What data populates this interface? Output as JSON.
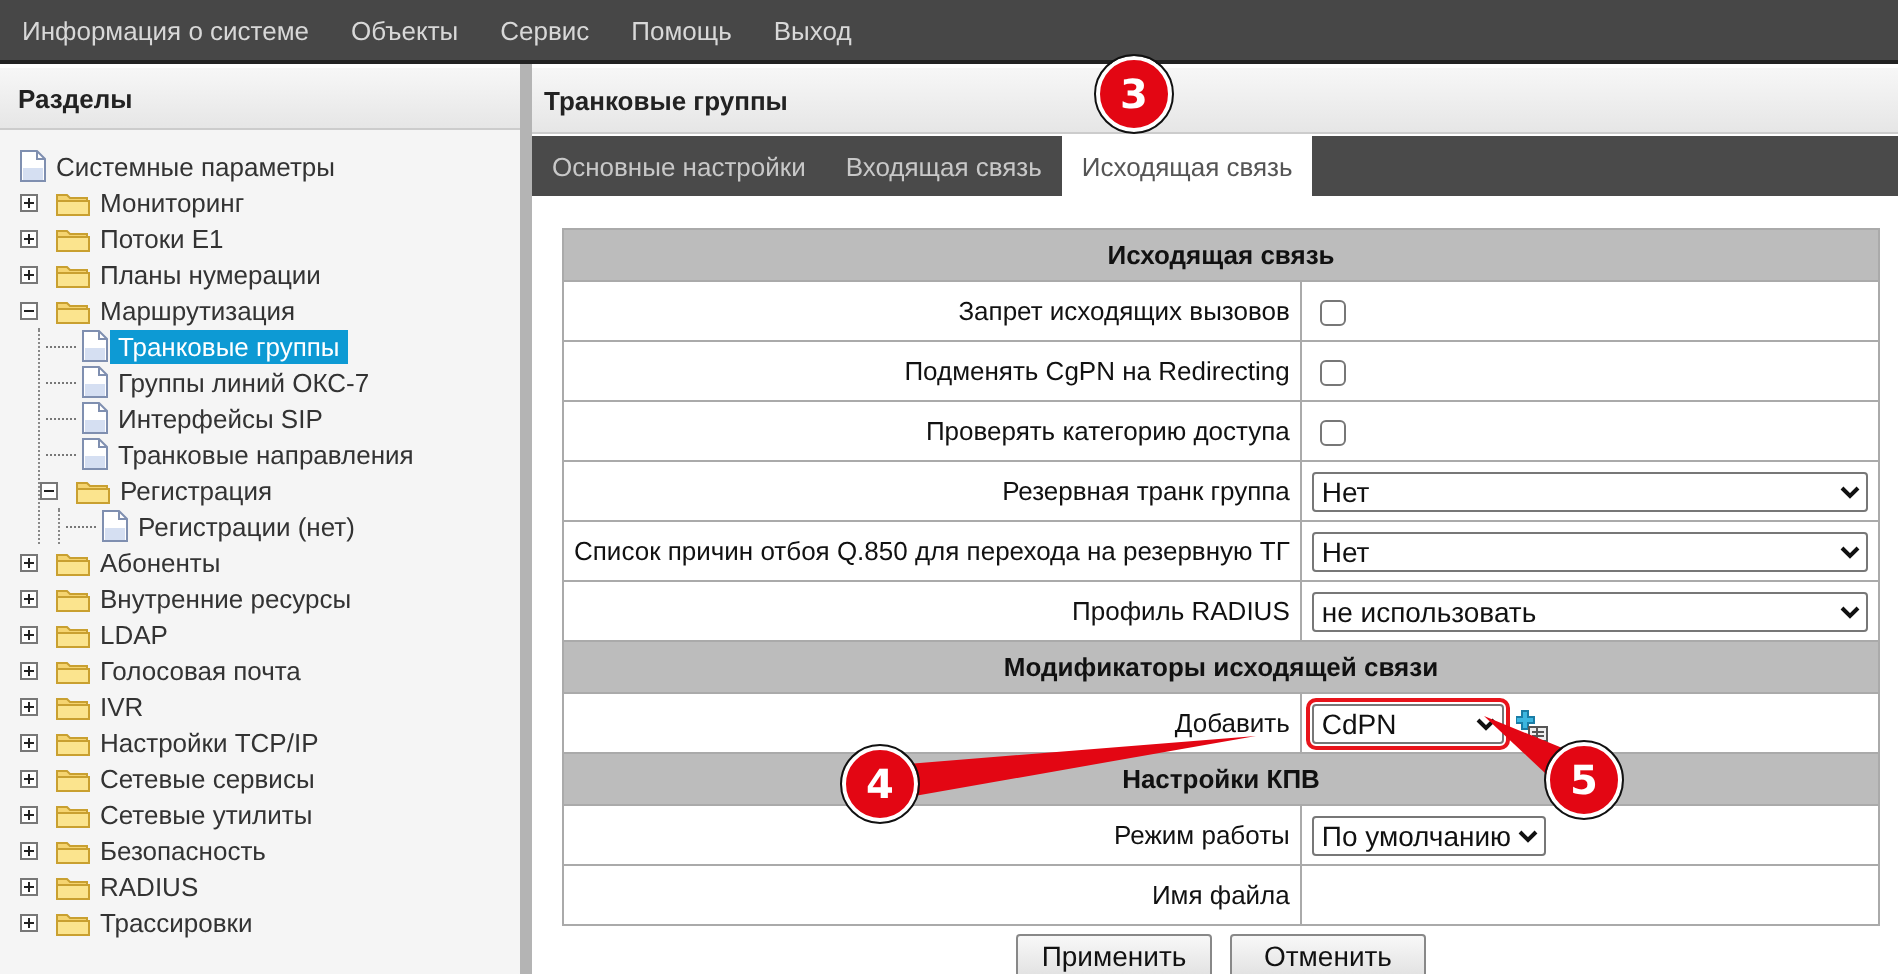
{
  "menu": [
    "Информация о системе",
    "Объекты",
    "Сервис",
    "Помощь",
    "Выход"
  ],
  "sidebar": {
    "title": "Разделы",
    "items": [
      {
        "label": "Системные параметры",
        "kind": "page",
        "selected": false
      },
      {
        "label": "Мониторинг",
        "kind": "folder",
        "expanded": false,
        "selected": false
      },
      {
        "label": "Потоки E1",
        "kind": "folder",
        "expanded": false,
        "selected": false
      },
      {
        "label": "Планы нумерации",
        "kind": "folder",
        "expanded": false,
        "selected": false
      },
      {
        "label": "Маршрутизация",
        "kind": "folder",
        "expanded": true,
        "selected": false,
        "children": [
          {
            "label": "Транковые группы",
            "kind": "page",
            "selected": true
          },
          {
            "label": "Группы линий ОКС-7",
            "kind": "page",
            "selected": false
          },
          {
            "label": "Интерфейсы SIP",
            "kind": "page",
            "selected": false
          },
          {
            "label": "Транковые направления",
            "kind": "page",
            "selected": false
          },
          {
            "label": "Регистрация",
            "kind": "folder",
            "expanded": true,
            "selected": false,
            "children": [
              {
                "label": "Регистрации (нет)",
                "kind": "page",
                "selected": false
              }
            ]
          }
        ]
      },
      {
        "label": "Абоненты",
        "kind": "folder",
        "expanded": false,
        "selected": false
      },
      {
        "label": "Внутренние ресурсы",
        "kind": "folder",
        "expanded": false,
        "selected": false
      },
      {
        "label": "LDAP",
        "kind": "folder",
        "expanded": false,
        "selected": false
      },
      {
        "label": "Голосовая почта",
        "kind": "folder",
        "expanded": false,
        "selected": false
      },
      {
        "label": "IVR",
        "kind": "folder",
        "expanded": false,
        "selected": false
      },
      {
        "label": "Настройки TCP/IP",
        "kind": "folder",
        "expanded": false,
        "selected": false
      },
      {
        "label": "Сетевые сервисы",
        "kind": "folder",
        "expanded": false,
        "selected": false
      },
      {
        "label": "Сетевые утилиты",
        "kind": "folder",
        "expanded": false,
        "selected": false
      },
      {
        "label": "Безопасность",
        "kind": "folder",
        "expanded": false,
        "selected": false
      },
      {
        "label": "RADIUS",
        "kind": "folder",
        "expanded": false,
        "selected": false
      },
      {
        "label": "Трассировки",
        "kind": "folder",
        "expanded": false,
        "selected": false
      }
    ]
  },
  "page": {
    "title": "Транковые группы",
    "tabs": [
      {
        "label": "Основные настройки",
        "selected": false
      },
      {
        "label": "Входящая связь",
        "selected": false
      },
      {
        "label": "Исходящая связь",
        "selected": true
      }
    ],
    "table": {
      "rows": [
        {
          "kind": "header",
          "label": "Исходящая связь"
        },
        {
          "kind": "checkbox",
          "label": "Запрет исходящих вызовов",
          "checked": false
        },
        {
          "kind": "checkbox",
          "label": "Подменять CgPN на Redirecting",
          "checked": false
        },
        {
          "kind": "checkbox",
          "label": "Проверять категорию доступа",
          "checked": false
        },
        {
          "kind": "select",
          "label": "Резервная транк группа",
          "value": "Нет"
        },
        {
          "kind": "select",
          "label": "Список причин отбоя Q.850 для перехода на резервную ТГ",
          "value": "Нет"
        },
        {
          "kind": "select",
          "label": "Профиль RADIUS",
          "value": "не использовать"
        },
        {
          "kind": "header",
          "label": "Модификаторы исходящей связи"
        },
        {
          "kind": "add",
          "label": "Добавить",
          "value": "CdPN",
          "highlighted": true
        },
        {
          "kind": "header",
          "label": "Настройки КПВ"
        },
        {
          "kind": "compact_select",
          "label": "Режим работы",
          "value": "По умолчанию"
        },
        {
          "kind": "empty",
          "label": "Имя файла"
        }
      ]
    },
    "buttons": [
      "Применить",
      "Отменить"
    ]
  },
  "callouts": [
    "3",
    "4",
    "5"
  ]
}
